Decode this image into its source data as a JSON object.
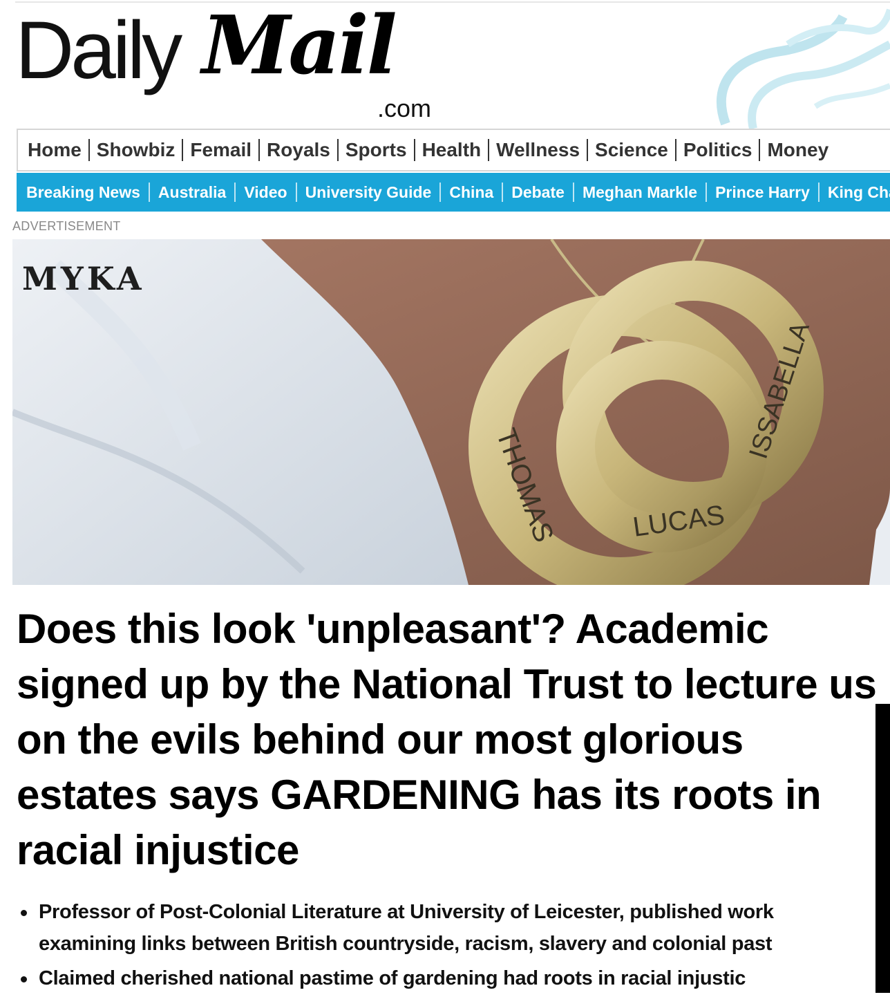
{
  "masthead": {
    "logo_daily": "Daily",
    "logo_mail": "Mail",
    "logo_com": ".com"
  },
  "nav_primary": [
    "Home",
    "Showbiz",
    "Femail",
    "Royals",
    "Sports",
    "Health",
    "Wellness",
    "Science",
    "Politics",
    "Money"
  ],
  "nav_secondary": [
    "Breaking News",
    "Australia",
    "Video",
    "University Guide",
    "China",
    "Debate",
    "Meghan Markle",
    "Prince Harry",
    "King Charles"
  ],
  "ad": {
    "label": "ADVERTISEMENT",
    "brand": "MYKA",
    "engraved_names": [
      "THOMAS",
      "LUCAS",
      "ISSABELLA"
    ]
  },
  "article": {
    "headline": "Does this look 'unpleasant'? Academic signed up by the National Trust to lecture us on the evils behind our most glorious estates says GARDENING has its roots in racial injustice",
    "bullets": [
      "Professor of Post-Colonial Literature at University of Leicester, published work examining links between British countryside, racism, slavery and colonial past",
      "Claimed cherished national pastime of gardening had roots in racial injustic"
    ]
  },
  "colors": {
    "secondary_nav": "#1aa5d8",
    "primary_nav_text": "#333333"
  }
}
